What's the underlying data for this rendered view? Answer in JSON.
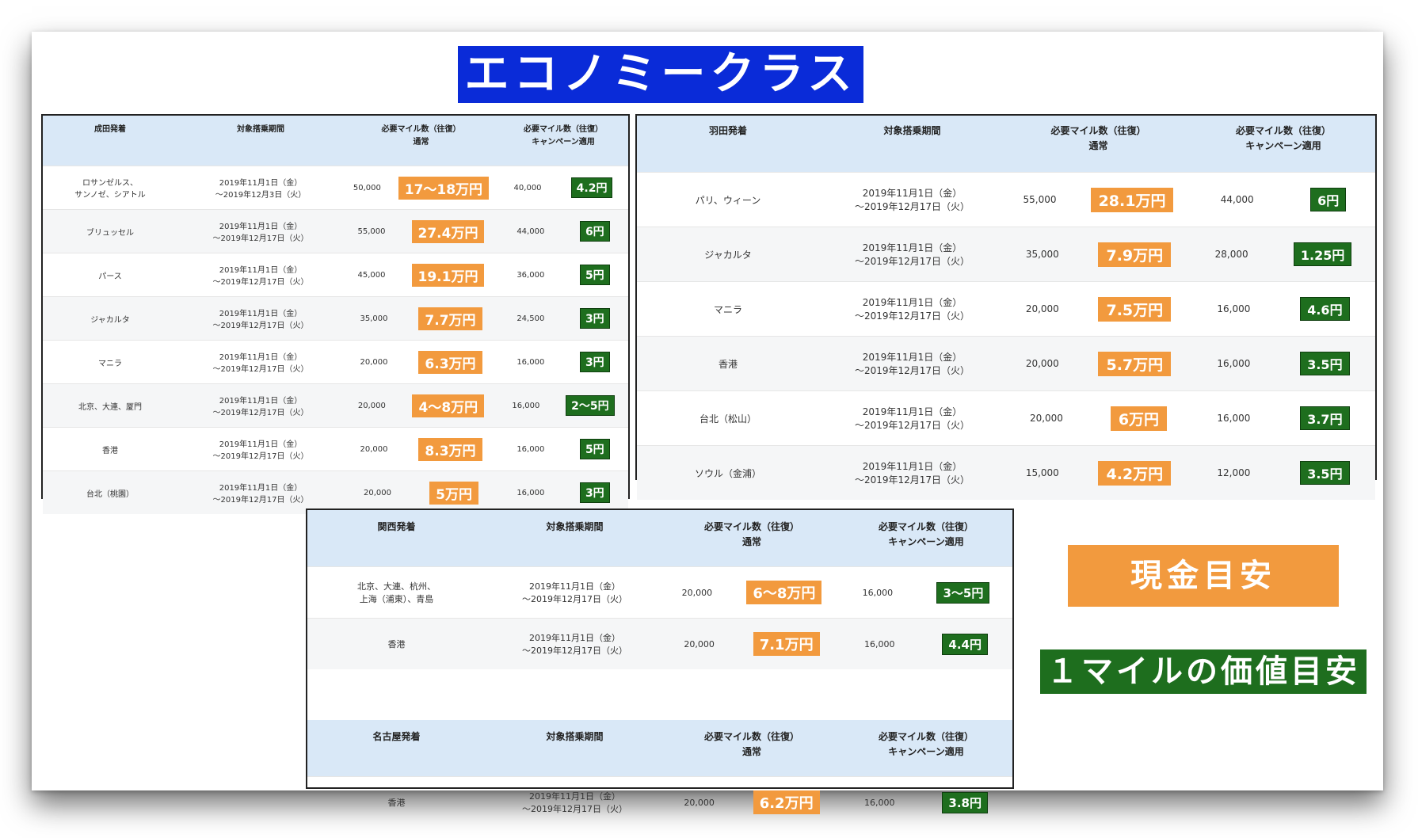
{
  "title": "エコノミークラス",
  "headers": {
    "period": "対象搭乗期間",
    "miles_normal_1": "必要マイル数（往復）",
    "miles_normal_2": "通常",
    "miles_campaign_1": "必要マイル数（往復）",
    "miles_campaign_2": "キャンペーン適用"
  },
  "narita": {
    "origin": "成田発着",
    "rows": [
      {
        "dest1": "ロサンゼルス、",
        "dest2": "サンノゼ、シアトル",
        "p1": "2019年11月1日（金）",
        "p2": "〜2019年12月3日（火）",
        "normal": "50,000",
        "cash": "17〜18万円",
        "campaign": "40,000",
        "value": "4.2円"
      },
      {
        "dest1": "ブリュッセル",
        "dest2": "",
        "p1": "2019年11月1日（金）",
        "p2": "〜2019年12月17日（火）",
        "normal": "55,000",
        "cash": "27.4万円",
        "campaign": "44,000",
        "value": "6円"
      },
      {
        "dest1": "パース",
        "dest2": "",
        "p1": "2019年11月1日（金）",
        "p2": "〜2019年12月17日（火）",
        "normal": "45,000",
        "cash": "19.1万円",
        "campaign": "36,000",
        "value": "5円"
      },
      {
        "dest1": "ジャカルタ",
        "dest2": "",
        "p1": "2019年11月1日（金）",
        "p2": "〜2019年12月17日（火）",
        "normal": "35,000",
        "cash": "7.7万円",
        "campaign": "24,500",
        "value": "3円"
      },
      {
        "dest1": "マニラ",
        "dest2": "",
        "p1": "2019年11月1日（金）",
        "p2": "〜2019年12月17日（火）",
        "normal": "20,000",
        "cash": "6.3万円",
        "campaign": "16,000",
        "value": "3円"
      },
      {
        "dest1": "北京、大連、厦門",
        "dest2": "",
        "p1": "2019年11月1日（金）",
        "p2": "〜2019年12月17日（火）",
        "normal": "20,000",
        "cash": "4〜8万円",
        "campaign": "16,000",
        "value": "2〜5円"
      },
      {
        "dest1": "香港",
        "dest2": "",
        "p1": "2019年11月1日（金）",
        "p2": "〜2019年12月17日（火）",
        "normal": "20,000",
        "cash": "8.3万円",
        "campaign": "16,000",
        "value": "5円"
      },
      {
        "dest1": "台北（桃園）",
        "dest2": "",
        "p1": "2019年11月1日（金）",
        "p2": "〜2019年12月17日（火）",
        "normal": "20,000",
        "cash": "5万円",
        "campaign": "16,000",
        "value": "3円"
      }
    ]
  },
  "haneda": {
    "origin": "羽田発着",
    "rows": [
      {
        "dest1": "パリ、ウィーン",
        "dest2": "",
        "p1": "2019年11月1日（金）",
        "p2": "〜2019年12月17日（火）",
        "normal": "55,000",
        "cash": "28.1万円",
        "campaign": "44,000",
        "value": "6円"
      },
      {
        "dest1": "ジャカルタ",
        "dest2": "",
        "p1": "2019年11月1日（金）",
        "p2": "〜2019年12月17日（火）",
        "normal": "35,000",
        "cash": "7.9万円",
        "campaign": "28,000",
        "value": "1.25円"
      },
      {
        "dest1": "マニラ",
        "dest2": "",
        "p1": "2019年11月1日（金）",
        "p2": "〜2019年12月17日（火）",
        "normal": "20,000",
        "cash": "7.5万円",
        "campaign": "16,000",
        "value": "4.6円"
      },
      {
        "dest1": "香港",
        "dest2": "",
        "p1": "2019年11月1日（金）",
        "p2": "〜2019年12月17日（火）",
        "normal": "20,000",
        "cash": "5.7万円",
        "campaign": "16,000",
        "value": "3.5円"
      },
      {
        "dest1": "台北（松山）",
        "dest2": "",
        "p1": "2019年11月1日（金）",
        "p2": "〜2019年12月17日（火）",
        "normal": "20,000",
        "cash": "6万円",
        "campaign": "16,000",
        "value": "3.7円"
      },
      {
        "dest1": "ソウル（金浦）",
        "dest2": "",
        "p1": "2019年11月1日（金）",
        "p2": "〜2019年12月17日（火）",
        "normal": "15,000",
        "cash": "4.2万円",
        "campaign": "12,000",
        "value": "3.5円"
      }
    ]
  },
  "kansai": {
    "origin": "関西発着",
    "rows": [
      {
        "dest1": "北京、大連、杭州、",
        "dest2": "上海（浦東）、青島",
        "p1": "2019年11月1日（金）",
        "p2": "〜2019年12月17日（火）",
        "normal": "20,000",
        "cash": "6〜8万円",
        "campaign": "16,000",
        "value": "3〜5円"
      },
      {
        "dest1": "香港",
        "dest2": "",
        "p1": "2019年11月1日（金）",
        "p2": "〜2019年12月17日（火）",
        "normal": "20,000",
        "cash": "7.1万円",
        "campaign": "16,000",
        "value": "4.4円"
      }
    ]
  },
  "nagoya": {
    "origin": "名古屋発着",
    "rows": [
      {
        "dest1": "香港",
        "dest2": "",
        "p1": "2019年11月1日（金）",
        "p2": "〜2019年12月17日（火）",
        "normal": "20,000",
        "cash": "6.2万円",
        "campaign": "16,000",
        "value": "3.8円"
      }
    ]
  },
  "legend": {
    "cash": "現金目安",
    "mile_value": "１マイルの価値目安"
  },
  "colors": {
    "cash_badge": "#f29a3e",
    "value_badge": "#1e6e1e",
    "banner": "#0a2bd8",
    "header_bg": "#d9e8f7"
  }
}
